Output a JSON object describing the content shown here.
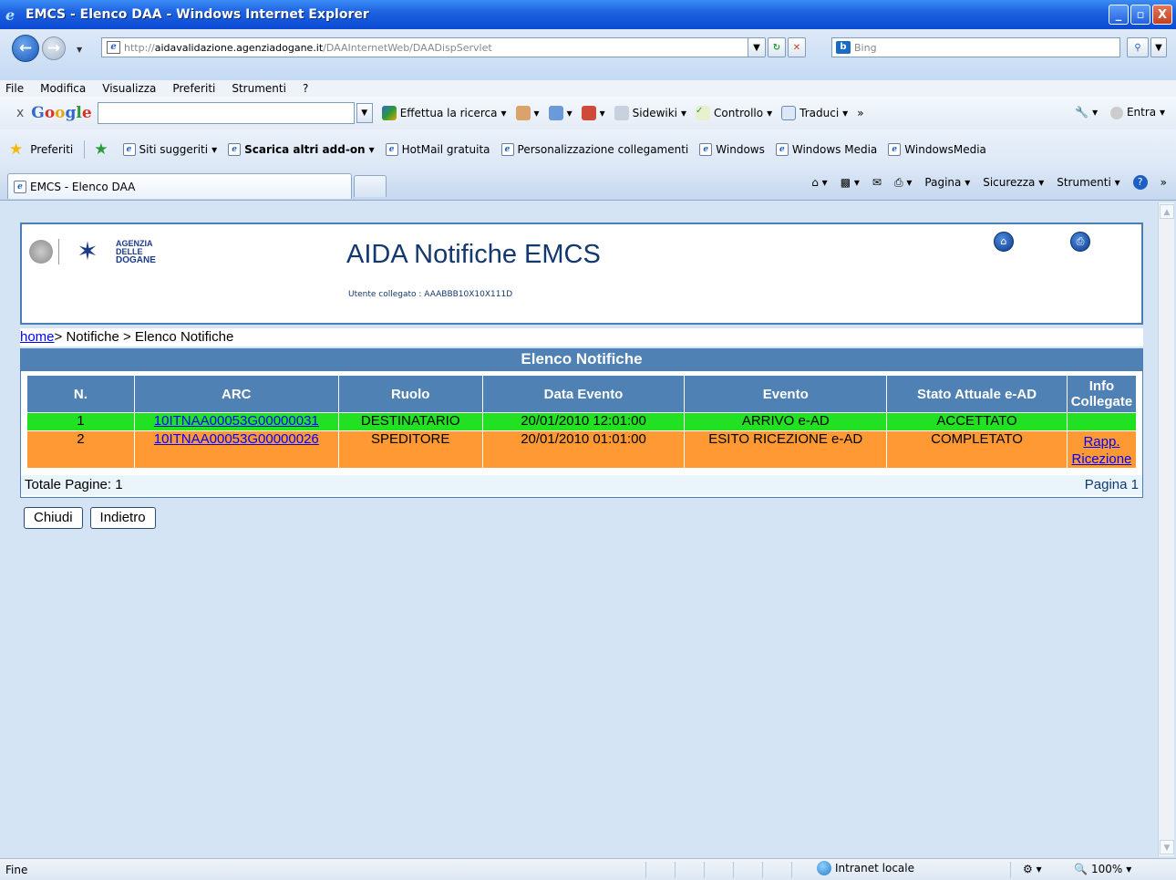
{
  "window": {
    "title": "EMCS - Elenco DAA - Windows Internet Explorer",
    "minimize": "_",
    "maximize": "▫",
    "close": "X"
  },
  "address": {
    "url_prefix": "http://",
    "url_domain": "aidavalidazione.agenziadogane.it",
    "url_path": "/DAAInternetWeb/DAADispServlet",
    "search_placeholder": "Bing"
  },
  "menu": [
    "File",
    "Modifica",
    "Visualizza",
    "Preferiti",
    "Strumenti",
    "?"
  ],
  "google_toolbar": {
    "close": "x",
    "search_label": "Effettua la ricerca",
    "sidewiki": "Sidewiki",
    "controllo": "Controllo",
    "traduci": "Traduci",
    "more": "»",
    "entra": "Entra"
  },
  "favorites": {
    "label": "Preferiti",
    "items": [
      "Siti suggeriti",
      "Scarica altri add-on",
      "HotMail gratuita",
      "Personalizzazione collegamenti",
      "Windows",
      "Windows Media",
      "WindowsMedia"
    ]
  },
  "tab": {
    "title": "EMCS - Elenco DAA"
  },
  "commandbar": {
    "pagina": "Pagina",
    "sicurezza": "Sicurezza",
    "strumenti": "Strumenti"
  },
  "page": {
    "logo_line1": "AGENZIA",
    "logo_line2": "DELLE",
    "logo_line3": "DOGANE",
    "app_title": "AIDA Notifiche EMCS",
    "user_info": "Utente collegato : AAABBB10X10X111D",
    "breadcrumb_home": "home",
    "breadcrumb_rest": "> Notifiche > Elenco Notifiche",
    "section_title": "Elenco Notifiche",
    "columns": [
      "N.",
      "ARC",
      "Ruolo",
      "Data Evento",
      "Evento",
      "Stato Attuale e-AD",
      "Info Collegate"
    ],
    "rows": [
      {
        "n": "1",
        "arc": "10ITNAA00053G00000031",
        "ruolo": "DESTINATARIO",
        "data": "20/01/2010 12:01:00",
        "evento": "ARRIVO e-AD",
        "stato": "ACCETTATO",
        "info": ""
      },
      {
        "n": "2",
        "arc": "10ITNAA00053G00000026",
        "ruolo": "SPEDITORE",
        "data": "20/01/2010 01:01:00",
        "evento": "ESITO RICEZIONE e-AD",
        "stato": "COMPLETATO",
        "info_line1": "Rapp.",
        "info_line2": "Ricezione"
      }
    ],
    "total_pages": "Totale Pagine: 1",
    "page_label": "Pagina 1",
    "btn_close": "Chiudi",
    "btn_back": "Indietro"
  },
  "status": {
    "text": "Fine",
    "zone": "Intranet locale",
    "zoom": "100%"
  }
}
